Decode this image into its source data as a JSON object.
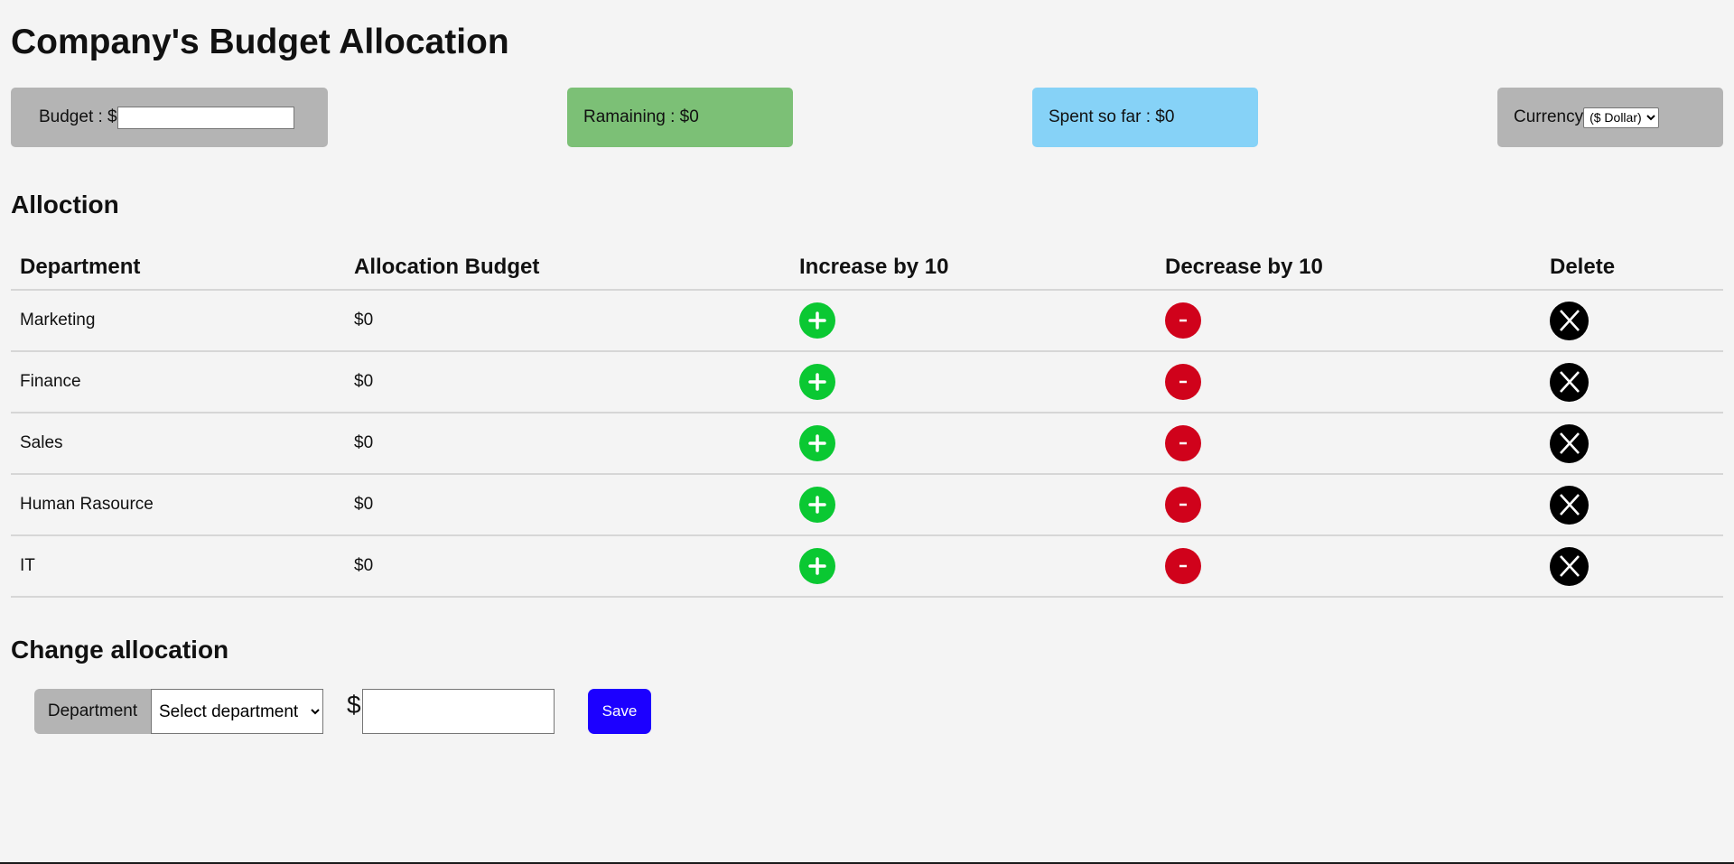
{
  "header": {
    "title": "Company's Budget Allocation"
  },
  "summary": {
    "budget_label": "Budget : $",
    "budget_value": "",
    "remaining_text": "Ramaining : $0",
    "spent_text": "Spent so far : $0",
    "currency_label": "Currency",
    "currency_selected": "($ Dollar)"
  },
  "allocation": {
    "title": "Alloction",
    "columns": [
      "Department",
      "Allocation Budget",
      "Increase by 10",
      "Decrease by 10",
      "Delete"
    ],
    "rows": [
      {
        "department": "Marketing",
        "budget": "$0"
      },
      {
        "department": "Finance",
        "budget": "$0"
      },
      {
        "department": "Sales",
        "budget": "$0"
      },
      {
        "department": "Human Rasource",
        "budget": "$0"
      },
      {
        "department": "IT",
        "budget": "$0"
      }
    ],
    "increase_symbol": "+",
    "decrease_symbol": "-",
    "delete_symbol": "X"
  },
  "change": {
    "title": "Change allocation",
    "department_label": "Department",
    "department_selected": "Select department",
    "currency_symbol": "$",
    "amount_value": "",
    "save_label": "Save"
  },
  "colors": {
    "background": "#f4f4f4",
    "remaining_card": "#7cc076",
    "spent_card": "#86d2f7",
    "neutral_card": "#b4b4b4",
    "increase_button": "#0ac832",
    "decrease_button": "#d0021b",
    "delete_button": "#000000",
    "save_button": "#1c00ff"
  }
}
